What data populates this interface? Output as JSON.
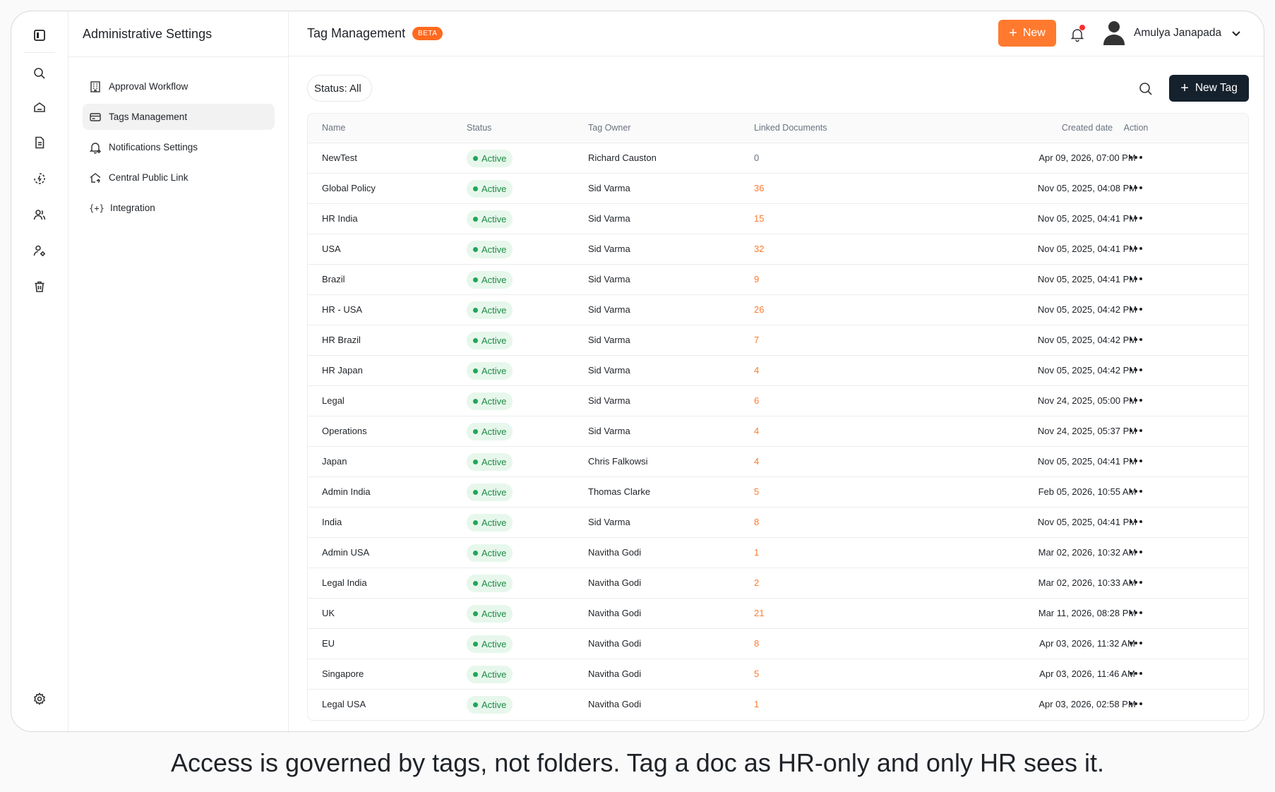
{
  "sidebar": {
    "title": "Administrative Settings",
    "items": [
      {
        "label": "Approval Workflow",
        "icon": "building-icon",
        "active": false
      },
      {
        "label": "Tags Management",
        "icon": "tag-card-icon",
        "active": true
      },
      {
        "label": "Notifications Settings",
        "icon": "bell-icon",
        "active": false
      },
      {
        "label": "Central Public Link",
        "icon": "home-link-icon",
        "active": false
      },
      {
        "label": "Integration",
        "icon": "braces-plus-icon",
        "active": false
      }
    ]
  },
  "header": {
    "title": "Tag Management",
    "badge": "BETA",
    "new_button": "New",
    "user_name": "Amulya Janapada"
  },
  "toolbar": {
    "status_filter": "Status: All",
    "new_tag_button": "New Tag"
  },
  "table": {
    "columns": [
      "Name",
      "Status",
      "Tag Owner",
      "Linked Documents",
      "Created date",
      "Action"
    ],
    "rows": [
      {
        "name": "NewTest",
        "status": "Active",
        "owner": "Richard Causton",
        "linked": "0",
        "created": "Apr 09, 2026, 07:00 PM"
      },
      {
        "name": "Global Policy",
        "status": "Active",
        "owner": "Sid Varma",
        "linked": "36",
        "created": "Nov 05, 2025, 04:08 PM"
      },
      {
        "name": "HR India",
        "status": "Active",
        "owner": "Sid Varma",
        "linked": "15",
        "created": "Nov 05, 2025, 04:41 PM"
      },
      {
        "name": "USA",
        "status": "Active",
        "owner": "Sid Varma",
        "linked": "32",
        "created": "Nov 05, 2025, 04:41 PM"
      },
      {
        "name": "Brazil",
        "status": "Active",
        "owner": "Sid Varma",
        "linked": "9",
        "created": "Nov 05, 2025, 04:41 PM"
      },
      {
        "name": "HR - USA",
        "status": "Active",
        "owner": "Sid Varma",
        "linked": "26",
        "created": "Nov 05, 2025, 04:42 PM"
      },
      {
        "name": "HR Brazil",
        "status": "Active",
        "owner": "Sid Varma",
        "linked": "7",
        "created": "Nov 05, 2025, 04:42 PM"
      },
      {
        "name": "HR Japan",
        "status": "Active",
        "owner": "Sid Varma",
        "linked": "4",
        "created": "Nov 05, 2025, 04:42 PM"
      },
      {
        "name": "Legal",
        "status": "Active",
        "owner": "Sid Varma",
        "linked": "6",
        "created": "Nov 24, 2025, 05:00 PM"
      },
      {
        "name": "Operations",
        "status": "Active",
        "owner": "Sid Varma",
        "linked": "4",
        "created": "Nov 24, 2025, 05:37 PM"
      },
      {
        "name": "Japan",
        "status": "Active",
        "owner": "Chris Falkowsi",
        "linked": "4",
        "created": "Nov 05, 2025, 04:41 PM"
      },
      {
        "name": "Admin India",
        "status": "Active",
        "owner": "Thomas Clarke",
        "linked": "5",
        "created": "Feb 05, 2026, 10:55 AM"
      },
      {
        "name": "India",
        "status": "Active",
        "owner": "Sid Varma",
        "linked": "8",
        "created": "Nov 05, 2025, 04:41 PM"
      },
      {
        "name": "Admin USA",
        "status": "Active",
        "owner": "Navitha Godi",
        "linked": "1",
        "created": "Mar 02, 2026, 10:32 AM"
      },
      {
        "name": "Legal India",
        "status": "Active",
        "owner": "Navitha Godi",
        "linked": "2",
        "created": "Mar 02, 2026, 10:33 AM"
      },
      {
        "name": "UK",
        "status": "Active",
        "owner": "Navitha Godi",
        "linked": "21",
        "created": "Mar 11, 2026, 08:28 PM"
      },
      {
        "name": "EU",
        "status": "Active",
        "owner": "Navitha Godi",
        "linked": "8",
        "created": "Apr 03, 2026, 11:32 AM"
      },
      {
        "name": "Singapore",
        "status": "Active",
        "owner": "Navitha Godi",
        "linked": "5",
        "created": "Apr 03, 2026, 11:46 AM"
      },
      {
        "name": "Legal USA",
        "status": "Active",
        "owner": "Navitha Godi",
        "linked": "1",
        "created": "Apr 03, 2026, 02:58 PM"
      }
    ]
  },
  "caption": "Access is governed by tags, not folders. Tag a doc as HR-only and only HR sees it.",
  "colors": {
    "accent": "#ff7a2e",
    "primary_dark": "#15212d",
    "status_active_bg": "#e7f7ec",
    "status_active_text": "#1d8a45"
  }
}
